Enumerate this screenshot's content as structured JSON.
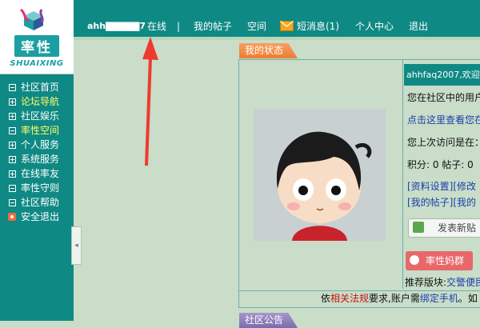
{
  "logo": {
    "brand_cn": "率性",
    "brand_en": "SHUAIXING"
  },
  "topbar": {
    "username": "ahh▇▇▇▇▇7",
    "online": "在线",
    "separator": "|",
    "links": {
      "my_posts": "我的帖子",
      "space": "空间",
      "messages": "短消息(1)",
      "profile": "个人中心",
      "logout": "退出"
    }
  },
  "sidebar": {
    "items": [
      {
        "label": "社区首页",
        "icon": "minus-box-icon"
      },
      {
        "label": "论坛导航",
        "icon": "plus-box-icon"
      },
      {
        "label": "社区娱乐",
        "icon": "plus-box-icon"
      },
      {
        "label": "率性空间",
        "icon": "minus-box-icon"
      },
      {
        "label": "个人服务",
        "icon": "plus-box-icon"
      },
      {
        "label": "系统服务",
        "icon": "plus-box-icon"
      },
      {
        "label": "在线率友",
        "icon": "plus-box-icon"
      },
      {
        "label": "率性守则",
        "icon": "minus-box-icon"
      },
      {
        "label": "社区帮助",
        "icon": "minus-box-icon"
      },
      {
        "label": "安全退出",
        "icon": "exit-icon"
      }
    ],
    "toggle": "◂"
  },
  "main": {
    "status_tab": "我的状态",
    "notice_tab": "社区公告",
    "welcome": "ahhfaq2007,欢迎",
    "line1": "您在社区中的用户",
    "line2": "点击这里查看您在",
    "line3": "您上次访问是在：",
    "stats": "积分: 0 帖子: 0",
    "links_row1": "[资料设置][修改",
    "links_row2": "[我的帖子][我的",
    "post_button": "发表新贴",
    "mom_button": "率性妈群",
    "recommend_label": "推荐版块:",
    "recommend_value": "交警便民",
    "bottom": {
      "prefix": "依",
      "laws": "相关法规",
      "mid": "要求,账户需",
      "bind": "绑定手机",
      "suffix": "。如"
    }
  },
  "colors": {
    "teal": "#0f8984",
    "background": "#c9ddc9",
    "tab_orange": "#ee7b32",
    "link_blue": "#1a3fa8",
    "warn_red": "#cc1111",
    "annotation_arrow": "#ee3b2f"
  }
}
